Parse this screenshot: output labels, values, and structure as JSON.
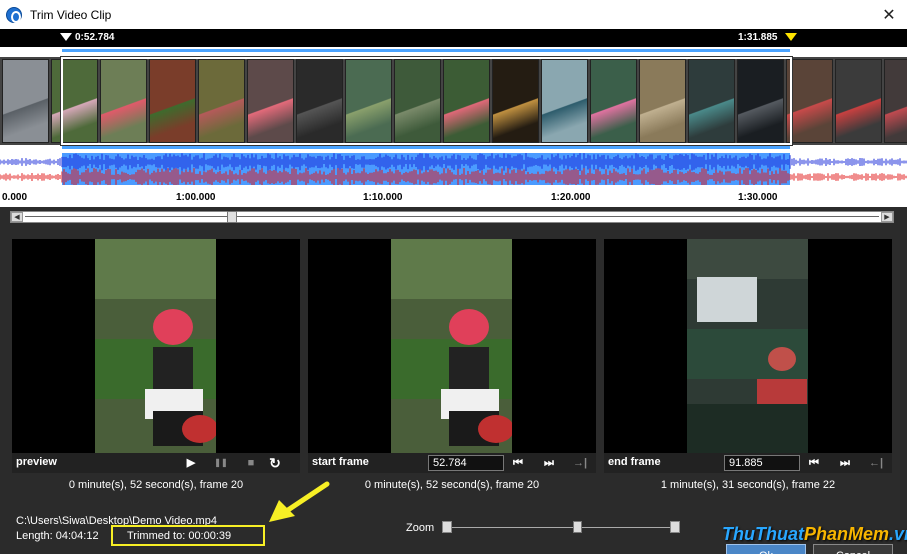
{
  "window": {
    "title": "Trim Video Clip",
    "close_glyph": "✕"
  },
  "trim": {
    "start_marker_time": "0:52.784",
    "end_marker_time": "1:31.885"
  },
  "thumbnails": [
    {
      "color": "#8a8f95",
      "accent": "#5a6066"
    },
    {
      "color": "#4e6a3a",
      "accent": "#d6a8b8"
    },
    {
      "color": "#6d7e56",
      "accent": "#e05a6a"
    },
    {
      "color": "#7a3d2a",
      "accent": "#3e6b2d"
    },
    {
      "color": "#6c6a3a",
      "accent": "#b55a5a"
    },
    {
      "color": "#5d4a4a",
      "accent": "#e36a7a"
    },
    {
      "color": "#2a2a2a",
      "accent": "#555555"
    },
    {
      "color": "#4b6b52",
      "accent": "#8aa06c"
    },
    {
      "color": "#3e5a3a",
      "accent": "#7a8a6a"
    },
    {
      "color": "#3c5c35",
      "accent": "#e06878"
    },
    {
      "color": "#241c12",
      "accent": "#c09040"
    },
    {
      "color": "#8aa7b0",
      "accent": "#2d5c6c"
    },
    {
      "color": "#3b5f4a",
      "accent": "#e072a0"
    },
    {
      "color": "#8a7a5a",
      "accent": "#c0b090"
    },
    {
      "color": "#2e3c3c",
      "accent": "#4a8a8a"
    },
    {
      "color": "#1a1e22",
      "accent": "#555a60"
    },
    {
      "color": "#5a4438",
      "accent": "#c84a4a"
    },
    {
      "color": "#3b3b3b",
      "accent": "#c84040"
    },
    {
      "color": "#423a3a",
      "accent": "#c04a50"
    }
  ],
  "timeline": {
    "ticks": [
      {
        "label": "0.000"
      },
      {
        "label": "1:00.000"
      },
      {
        "label": "1:10.000"
      },
      {
        "label": "1:20.000"
      },
      {
        "label": "1:30.000"
      }
    ]
  },
  "panels": {
    "preview": {
      "label": "preview",
      "caption": "0 minute(s), 52 second(s), frame 20",
      "buttons": {
        "play": "▶",
        "pause": "❚❚",
        "stop": "■",
        "loop": "↻"
      }
    },
    "start_frame": {
      "label": "start frame",
      "value": "52.784",
      "caption": "0 minute(s), 52 second(s), frame 20",
      "buttons": {
        "prev": "⏮",
        "next": "⏭",
        "set": "→|"
      }
    },
    "end_frame": {
      "label": "end frame",
      "value": "91.885",
      "caption": "1 minute(s), 31 second(s), frame 22",
      "buttons": {
        "prev": "⏮",
        "next": "⏭",
        "set": "←|"
      }
    }
  },
  "footer": {
    "path": "C:\\Users\\Siwa\\Desktop\\Demo Video.mp4",
    "length": "Length: 04:04:12",
    "trimmed": "Trimmed to: 00:00:39",
    "zoom_label": "Zoom",
    "zoom_level": 0.58,
    "ok_label": "Ok",
    "cancel_label": "Cancel"
  },
  "watermark": {
    "part1": "Thu",
    "part2": "Thuat",
    "part3": "PhanMem",
    "part4": ".vn"
  },
  "colors": {
    "selection": "#4aa3ff",
    "wave_blue": "#1a2bd8",
    "wave_red": "#e01818",
    "highlight": "#f7ef25"
  }
}
